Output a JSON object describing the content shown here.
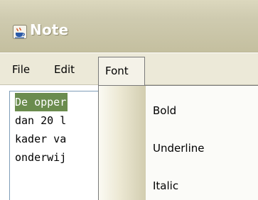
{
  "window": {
    "title": "Note",
    "icon": "java-coffee-cup-icon"
  },
  "menubar": {
    "items": [
      {
        "label": "File"
      },
      {
        "label": "Edit"
      },
      {
        "label": "Font",
        "active": true
      }
    ]
  },
  "editor": {
    "lines": [
      {
        "text": "De opper",
        "selected": true
      },
      {
        "text": "dan 20 l",
        "selected": false
      },
      {
        "text": "kader va",
        "selected": false
      },
      {
        "text": "onderwij",
        "selected": false
      }
    ]
  },
  "font_menu": {
    "items": [
      {
        "label": "Bold"
      },
      {
        "label": "Underline"
      },
      {
        "label": "Italic"
      }
    ]
  },
  "colors": {
    "selection": "#6b8c4e",
    "titlebar": "#c4bf9f",
    "menubar": "#ece9d8"
  }
}
